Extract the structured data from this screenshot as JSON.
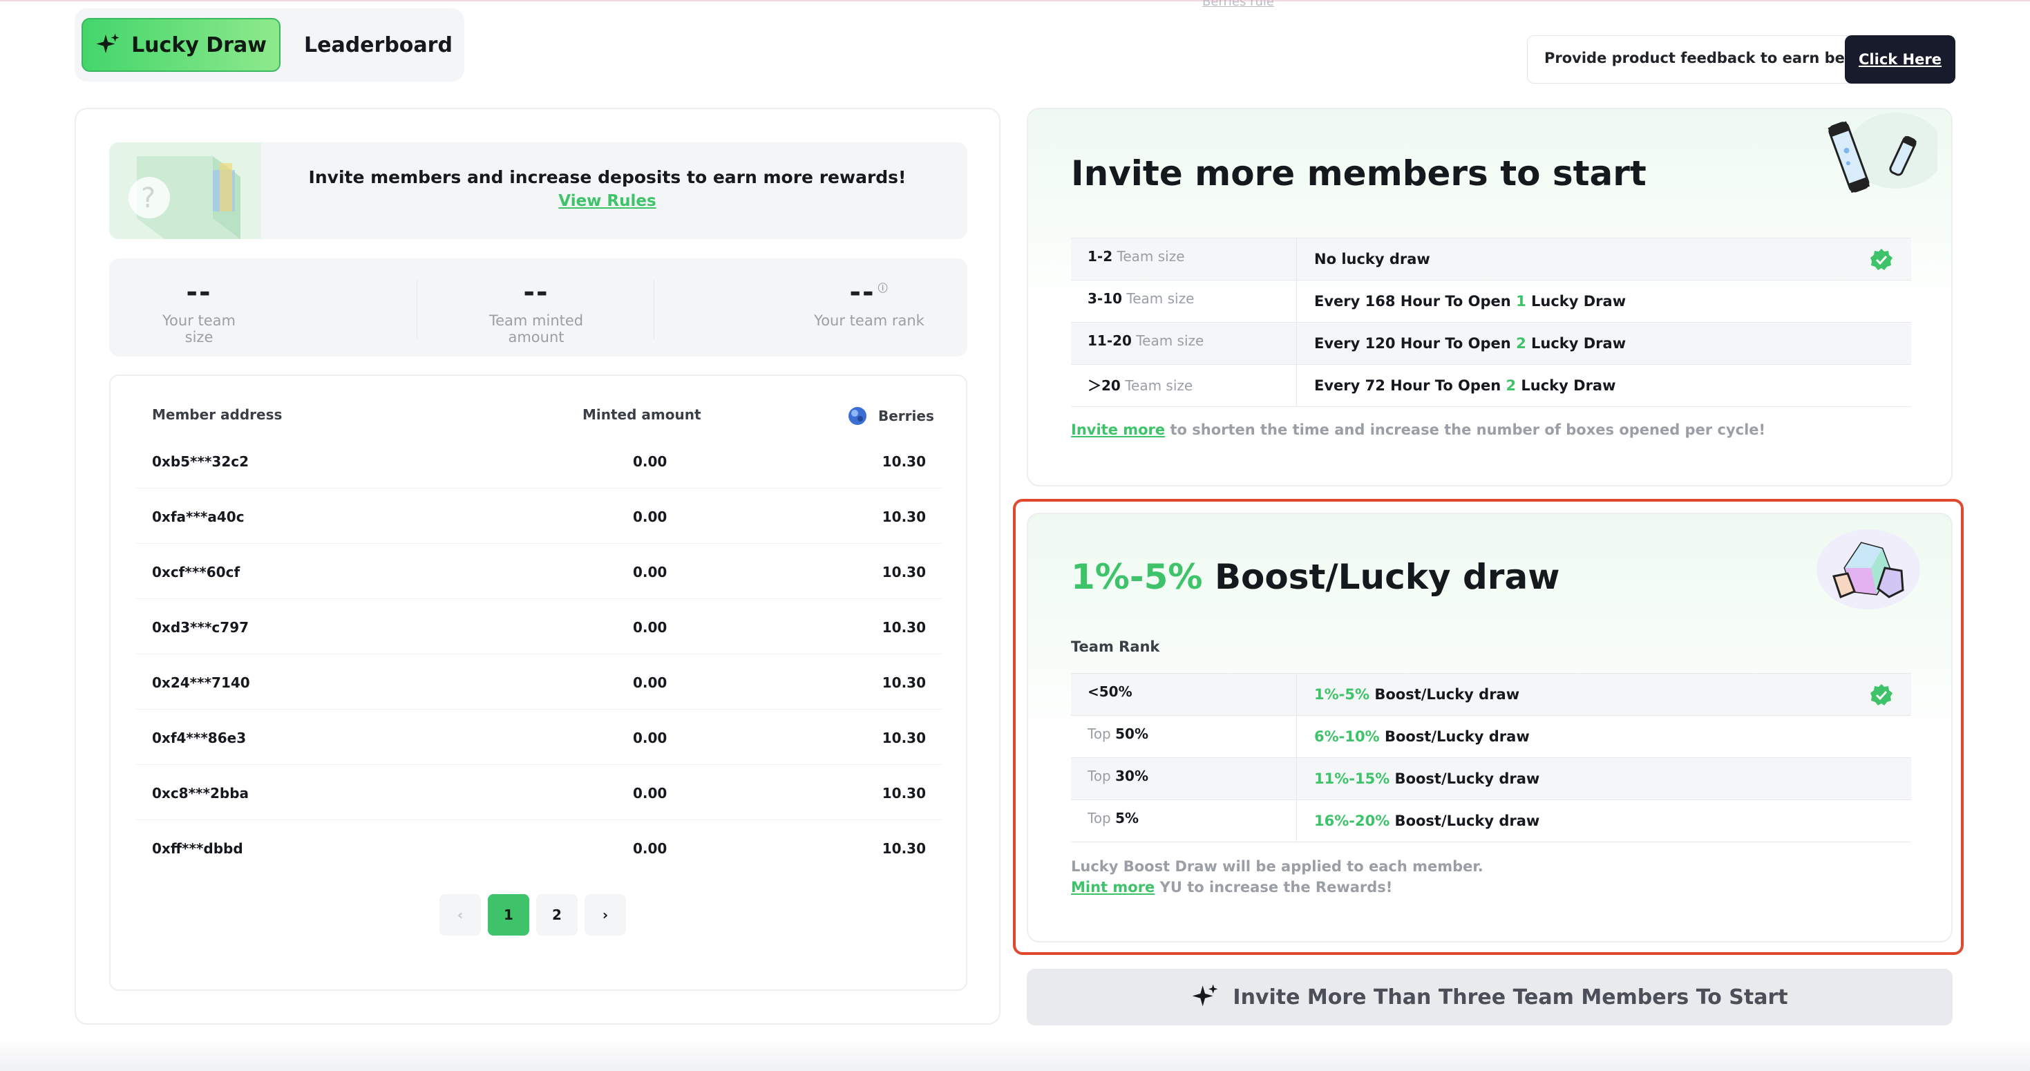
{
  "top": {
    "berries_rule": "Berries rule"
  },
  "tabs": {
    "lucky_draw": "Lucky Draw",
    "leaderboard": "Leaderboard"
  },
  "feedback": {
    "text": "Provide product feedback to earn berries!",
    "button": "Click Here"
  },
  "banner": {
    "text": "Invite members and increase deposits to earn more rewards!",
    "link": "View Rules"
  },
  "stats": [
    {
      "value": "--",
      "label": "Your team size"
    },
    {
      "value": "--",
      "label": "Team minted amount"
    },
    {
      "value": "--",
      "label": "Your team rank"
    }
  ],
  "members": {
    "headers": {
      "address": "Member address",
      "minted": "Minted amount",
      "berries": "Berries"
    },
    "rows": [
      {
        "address": "0xb5***32c2",
        "minted": "0.00",
        "berries": "10.30"
      },
      {
        "address": "0xfa***a40c",
        "minted": "0.00",
        "berries": "10.30"
      },
      {
        "address": "0xcf***60cf",
        "minted": "0.00",
        "berries": "10.30"
      },
      {
        "address": "0xd3***c797",
        "minted": "0.00",
        "berries": "10.30"
      },
      {
        "address": "0x24***7140",
        "minted": "0.00",
        "berries": "10.30"
      },
      {
        "address": "0xf4***86e3",
        "minted": "0.00",
        "berries": "10.30"
      },
      {
        "address": "0xc8***2bba",
        "minted": "0.00",
        "berries": "10.30"
      },
      {
        "address": "0xff***dbbd",
        "minted": "0.00",
        "berries": "10.30"
      }
    ],
    "pager": {
      "prev": "‹",
      "page1": "1",
      "page2": "2",
      "next": "›"
    }
  },
  "card1": {
    "title": "Invite more members to start",
    "rows": [
      {
        "range": "1-2",
        "unit": "Team size",
        "pre": "No lucky draw",
        "num": "",
        "post": "",
        "checked": true
      },
      {
        "range": "3-10",
        "unit": "Team size",
        "pre": "Every 168 Hour To Open ",
        "num": "1",
        "post": " Lucky Draw",
        "checked": false
      },
      {
        "range": "11-20",
        "unit": "Team size",
        "pre": "Every 120 Hour To Open ",
        "num": "2",
        "post": " Lucky Draw",
        "checked": false
      },
      {
        "range": "＞20",
        "unit": "Team size",
        "pre": "Every 72 Hour To Open ",
        "num": "2",
        "post": " Lucky Draw",
        "checked": false
      }
    ],
    "footer_link": "Invite more",
    "footer_text": " to shorten the time and increase the number of boxes opened per cycle!"
  },
  "card2": {
    "title_green": "1%-5%",
    "title_rest": " Boost/Lucky draw",
    "subtitle": "Team Rank",
    "rows": [
      {
        "prefix": "",
        "rank": "<50%",
        "pct": "1%-5%",
        "rest": " Boost/Lucky draw",
        "checked": true
      },
      {
        "prefix": "Top ",
        "rank": "50%",
        "pct": "6%-10%",
        "rest": " Boost/Lucky draw",
        "checked": false
      },
      {
        "prefix": "Top ",
        "rank": "30%",
        "pct": "11%-15%",
        "rest": " Boost/Lucky draw",
        "checked": false
      },
      {
        "prefix": "Top ",
        "rank": "5%",
        "pct": "16%-20%",
        "rest": " Boost/Lucky draw",
        "checked": false
      }
    ],
    "note": "Lucky Boost Draw will be applied to each member.",
    "footer_link": "Mint more",
    "footer_text": " YU to increase the Rewards!"
  },
  "invite_button": "Invite More Than Three Team Members To Start",
  "colors": {
    "accent": "#3ec36a",
    "highlight": "#e0482f",
    "dark_button": "#171b2c"
  }
}
